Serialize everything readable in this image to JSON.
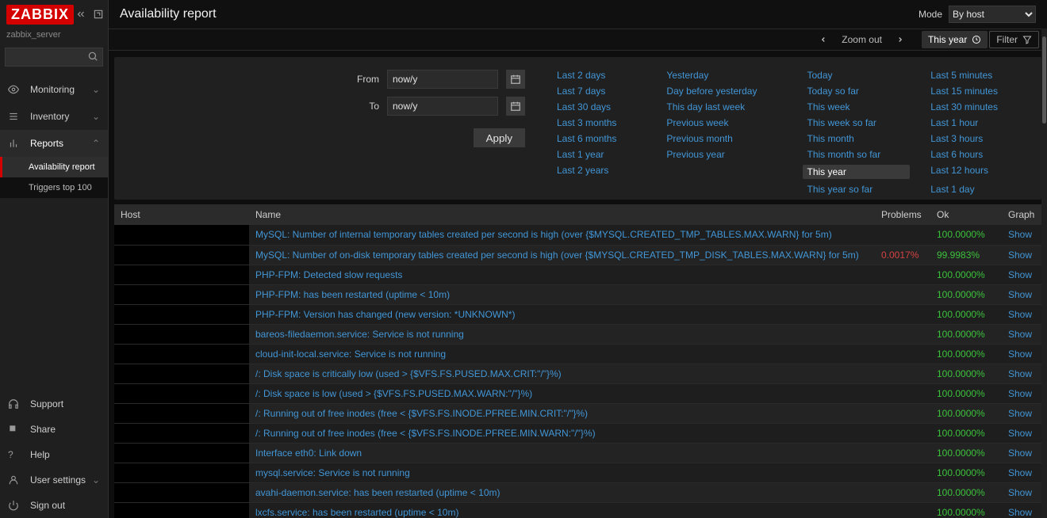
{
  "brand": "ZABBIX",
  "server_name": "zabbix_server",
  "search": {
    "placeholder": ""
  },
  "nav": {
    "monitoring": "Monitoring",
    "inventory": "Inventory",
    "reports": "Reports",
    "reports_sub": {
      "availability": "Availability report",
      "triggers_top": "Triggers top 100"
    },
    "support": "Support",
    "share": "Share",
    "help": "Help",
    "user": "User settings",
    "signout": "Sign out"
  },
  "header": {
    "title": "Availability report",
    "mode_label": "Mode",
    "mode_value": "By host"
  },
  "toolbar": {
    "zoom_out": "Zoom out",
    "range_label": "This year",
    "filter_label": "Filter"
  },
  "time": {
    "from_label": "From",
    "from_value": "now/y",
    "to_label": "To",
    "to_value": "now/y",
    "apply": "Apply",
    "presets_col1": [
      "Last 2 days",
      "Last 7 days",
      "Last 30 days",
      "Last 3 months",
      "Last 6 months",
      "Last 1 year",
      "Last 2 years"
    ],
    "presets_col2": [
      "Yesterday",
      "Day before yesterday",
      "This day last week",
      "Previous week",
      "Previous month",
      "Previous year"
    ],
    "presets_col3": [
      "Today",
      "Today so far",
      "This week",
      "This week so far",
      "This month",
      "This month so far",
      "This year",
      "This year so far"
    ],
    "presets_col4": [
      "Last 5 minutes",
      "Last 15 minutes",
      "Last 30 minutes",
      "Last 1 hour",
      "Last 3 hours",
      "Last 6 hours",
      "Last 12 hours",
      "Last 1 day"
    ],
    "selected_preset": "This year"
  },
  "table": {
    "headers": {
      "host": "Host",
      "name": "Name",
      "problems": "Problems",
      "ok": "Ok",
      "graph": "Graph"
    },
    "show_label": "Show",
    "rows": [
      {
        "name": "MySQL: Number of internal temporary tables created per second is high (over {$MYSQL.CREATED_TMP_TABLES.MAX.WARN} for 5m)",
        "problems": "",
        "ok": "100.0000%"
      },
      {
        "name": "MySQL: Number of on-disk temporary tables created per second is high (over {$MYSQL.CREATED_TMP_DISK_TABLES.MAX.WARN} for 5m)",
        "problems": "0.0017%",
        "ok": "99.9983%"
      },
      {
        "name": "PHP-FPM: Detected slow requests",
        "problems": "",
        "ok": "100.0000%"
      },
      {
        "name": "PHP-FPM: has been restarted (uptime < 10m)",
        "problems": "",
        "ok": "100.0000%"
      },
      {
        "name": "PHP-FPM: Version has changed (new version: *UNKNOWN*)",
        "problems": "",
        "ok": "100.0000%"
      },
      {
        "name": "bareos-filedaemon.service: Service is not running",
        "problems": "",
        "ok": "100.0000%"
      },
      {
        "name": "cloud-init-local.service: Service is not running",
        "problems": "",
        "ok": "100.0000%"
      },
      {
        "name": "/: Disk space is critically low (used > {$VFS.FS.PUSED.MAX.CRIT:\"/\"}%)",
        "problems": "",
        "ok": "100.0000%"
      },
      {
        "name": "/: Disk space is low (used > {$VFS.FS.PUSED.MAX.WARN:\"/\"}%)",
        "problems": "",
        "ok": "100.0000%"
      },
      {
        "name": "/: Running out of free inodes (free < {$VFS.FS.INODE.PFREE.MIN.CRIT:\"/\"}%)",
        "problems": "",
        "ok": "100.0000%"
      },
      {
        "name": "/: Running out of free inodes (free < {$VFS.FS.INODE.PFREE.MIN.WARN:\"/\"}%)",
        "problems": "",
        "ok": "100.0000%"
      },
      {
        "name": "Interface eth0: Link down",
        "problems": "",
        "ok": "100.0000%"
      },
      {
        "name": "mysql.service: Service is not running",
        "problems": "",
        "ok": "100.0000%"
      },
      {
        "name": "avahi-daemon.service: has been restarted (uptime < 10m)",
        "problems": "",
        "ok": "100.0000%"
      },
      {
        "name": "lxcfs.service: has been restarted (uptime < 10m)",
        "problems": "",
        "ok": "100.0000%"
      }
    ]
  }
}
